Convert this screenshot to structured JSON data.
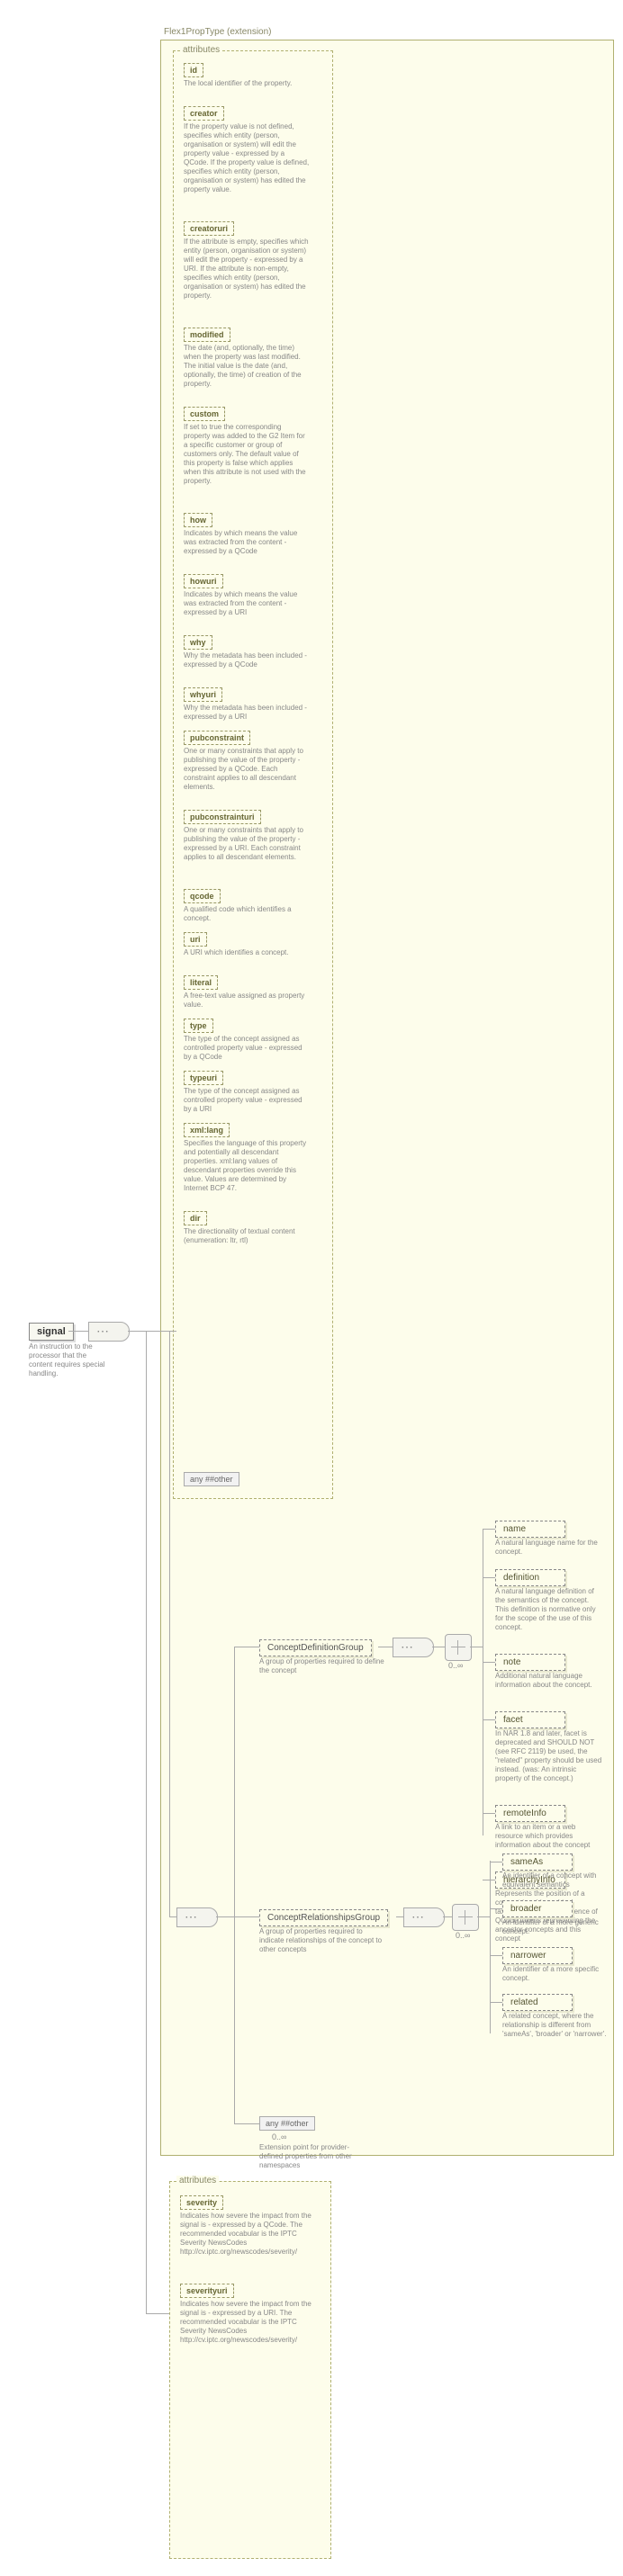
{
  "ext_title": "Flex1PropType (extension)",
  "attributes_label": "attributes",
  "root": {
    "name": "signal",
    "desc": "An instruction to the processor that the content requires special handling."
  },
  "attrs": [
    {
      "name": "id",
      "desc": "The local identifier of the property."
    },
    {
      "name": "creator",
      "desc": "If the property value is not defined, specifies which entity (person, organisation or system) will edit the property value - expressed by a QCode. If the property value is defined, specifies which entity (person, organisation or system) has edited the property value."
    },
    {
      "name": "creatoruri",
      "desc": "If the attribute is empty, specifies which entity (person, organisation or system) will edit the property - expressed by a URI. If the attribute is non-empty, specifies which entity (person, organisation or system) has edited the property."
    },
    {
      "name": "modified",
      "desc": "The date (and, optionally, the time) when the property was last modified. The initial value is the date (and, optionally, the time) of creation of the property."
    },
    {
      "name": "custom",
      "desc": "If set to true the corresponding property was added to the G2 Item for a specific customer or group of customers only. The default value of this property is false which applies when this attribute is not used with the property."
    },
    {
      "name": "how",
      "desc": "Indicates by which means the value was extracted from the content - expressed by a QCode"
    },
    {
      "name": "howuri",
      "desc": "Indicates by which means the value was extracted from the content - expressed by a URI"
    },
    {
      "name": "why",
      "desc": "Why the metadata has been included - expressed by a QCode"
    },
    {
      "name": "whyuri",
      "desc": "Why the metadata has been included - expressed by a URI"
    },
    {
      "name": "pubconstraint",
      "desc": "One or many constraints that apply to publishing the value of the property - expressed by a QCode. Each constraint applies to all descendant elements."
    },
    {
      "name": "pubconstrainturi",
      "desc": "One or many constraints that apply to publishing the value of the property - expressed by a URI. Each constraint applies to all descendant elements."
    },
    {
      "name": "qcode",
      "desc": "A qualified code which identifies a concept."
    },
    {
      "name": "uri",
      "desc": "A URI which identifies a concept."
    },
    {
      "name": "literal",
      "desc": "A free-text value assigned as property value."
    },
    {
      "name": "type",
      "desc": "The type of the concept assigned as controlled property value - expressed by a QCode"
    },
    {
      "name": "typeuri",
      "desc": "The type of the concept assigned as controlled property value - expressed by a URI"
    },
    {
      "name": "xml:lang",
      "desc": "Specifies the language of this property and potentially all descendant properties. xml:lang values of descendant properties override this value. Values are determined by Internet BCP 47."
    },
    {
      "name": "dir",
      "desc": "The directionality of textual content (enumeration: ltr, rtl)"
    }
  ],
  "any_other": "any ##other",
  "groups": {
    "def": {
      "name": "ConceptDefinitionGroup",
      "desc": "A group of properties required to define the concept"
    },
    "rel": {
      "name": "ConceptRelationshipsGroup",
      "desc": "A group of properties required to indicate relationships of the concept to other concepts"
    }
  },
  "any_ext": {
    "label": "any ##other",
    "occurs": "0..∞",
    "desc": "Extension point for provider-defined properties from other namespaces"
  },
  "def_children": [
    {
      "name": "name",
      "desc": "A natural language name for the concept."
    },
    {
      "name": "definition",
      "desc": "A natural language definition of the semantics of the concept. This definition is normative only for the scope of the use of this concept."
    },
    {
      "name": "note",
      "desc": "Additional natural language information about the concept."
    },
    {
      "name": "facet",
      "desc": "In NAR 1.8 and later, facet is deprecated and SHOULD NOT (see RFC 2119) be used, the \"related\" property should be used instead. (was: An intrinsic property of the concept.)"
    },
    {
      "name": "remoteInfo",
      "desc": "A link to an item or a web resource which provides information about the concept"
    },
    {
      "name": "hierarchyInfo",
      "desc": "Represents the position of a concept in a hierarchical taxonomy tree by a sequence of QCode tokens representing the ancestor concepts and this concept"
    }
  ],
  "rel_children": [
    {
      "name": "sameAs",
      "desc": "An identifier of a concept with equivalent semantics"
    },
    {
      "name": "broader",
      "desc": "An identifier of a more generic concept."
    },
    {
      "name": "narrower",
      "desc": "An identifier of a more specific concept."
    },
    {
      "name": "related",
      "desc": "A related concept, where the relationship is different from 'sameAs', 'broader' or 'narrower'."
    }
  ],
  "bottom_attrs": {
    "label": "attributes",
    "items": [
      {
        "name": "severity",
        "desc": "Indicates how severe the impact from the signal is - expressed by a QCode. The recommended vocabular is the IPTC Severity NewsCodes http://cv.iptc.org/newscodes/severity/"
      },
      {
        "name": "severityuri",
        "desc": "Indicates how severe the impact from the signal is - expressed by a URI. The recommended vocabular is the IPTC Severity NewsCodes http://cv.iptc.org/newscodes/severity/"
      }
    ]
  },
  "occurs_0inf": "0..∞"
}
